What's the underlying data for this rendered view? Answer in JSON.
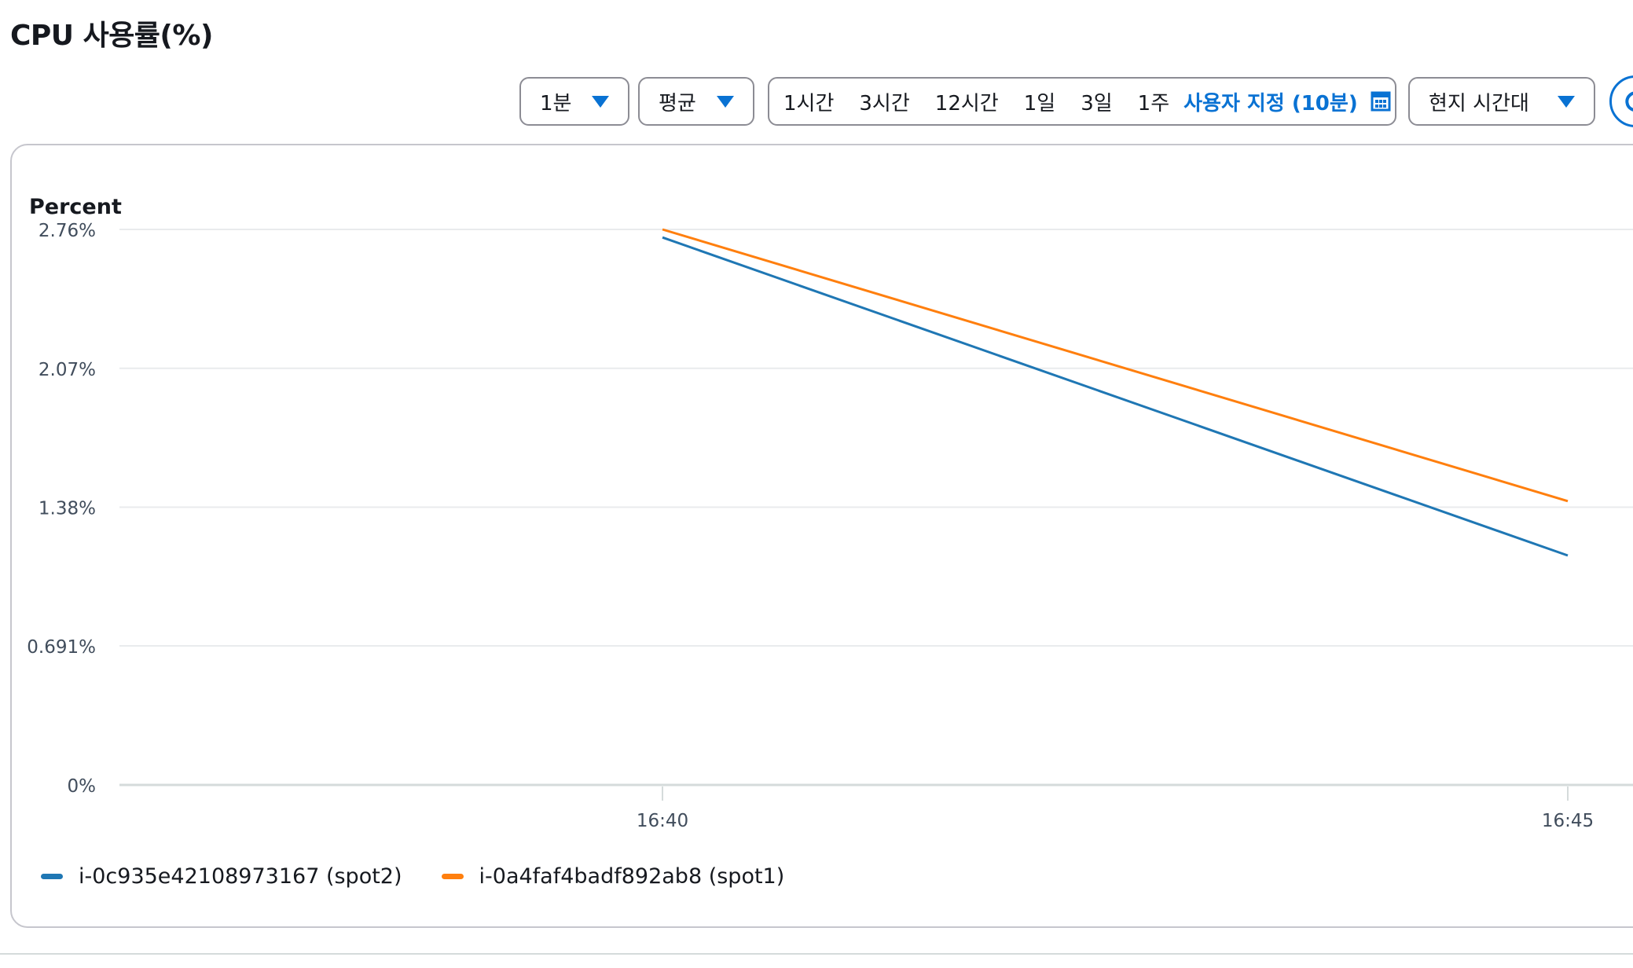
{
  "page_title": "CPU 사용률(%)",
  "toolbar": {
    "period": "1분",
    "statistic": "평균",
    "ranges": [
      "1시간",
      "3시간",
      "12시간",
      "1일",
      "3일",
      "1주"
    ],
    "custom_range": "사용자 지정 (10분)",
    "timezone": "현지 시간대"
  },
  "colors": {
    "accent": "#0972d3",
    "series_blue": "#1f77b4",
    "series_orange": "#ff7f0e",
    "grid": "#e9ebed"
  },
  "chart_data": {
    "type": "line",
    "ylabel": "Percent",
    "y_ticks": [
      "2.76%",
      "2.07%",
      "1.38%",
      "0.691%",
      "0%"
    ],
    "y_tick_values": [
      2.76,
      2.07,
      1.38,
      0.691,
      0
    ],
    "ylim": [
      0,
      2.76
    ],
    "x_ticks": [
      "16:40",
      "16:45"
    ],
    "x": [
      "16:40",
      "16:45"
    ],
    "grid": true,
    "legend_position": "bottom-left",
    "series": [
      {
        "name": "i-0c935e42108973167 (spot2)",
        "color": "#1f77b4",
        "values": [
          2.72,
          1.14
        ]
      },
      {
        "name": "i-0a4faf4badf892ab8 (spot1)",
        "color": "#ff7f0e",
        "values": [
          2.76,
          1.41
        ]
      }
    ]
  }
}
